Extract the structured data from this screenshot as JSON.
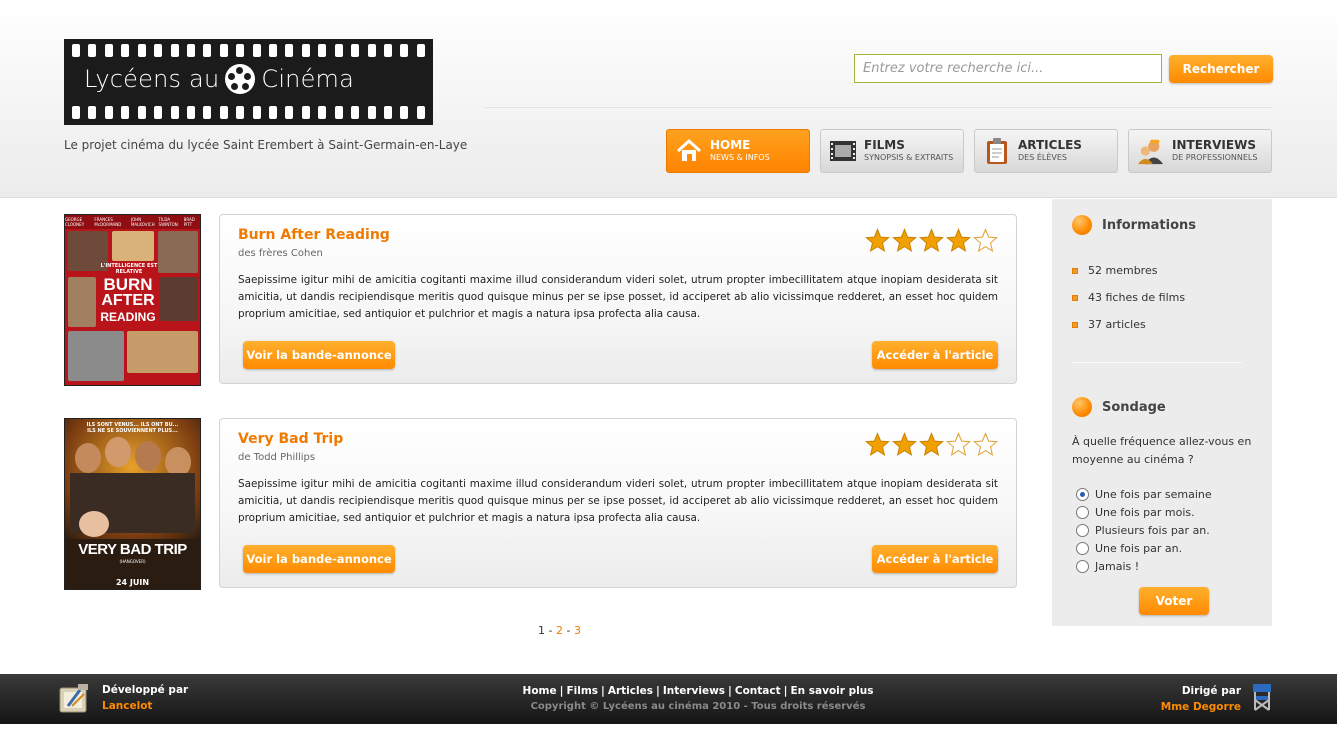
{
  "header": {
    "logo_text_left": "Lycéens au",
    "logo_text_right": "Cinéma",
    "tagline": "Le projet cinéma du lycée Saint Erembert à Saint-Germain-en-Laye",
    "search": {
      "placeholder": "Entrez votre recherche ici...",
      "button_label": "Rechercher"
    },
    "nav": [
      {
        "title": "HOME",
        "subtitle": "NEWS & INFOS",
        "icon": "house-icon",
        "active": true
      },
      {
        "title": "FILMS",
        "subtitle": "SYNOPSIS & EXTRAITS",
        "icon": "film-strip-icon",
        "active": false
      },
      {
        "title": "ARTICLES",
        "subtitle": "DES ÉLÈVES",
        "icon": "clipboard-icon",
        "active": false
      },
      {
        "title": "INTERVIEWS",
        "subtitle": "DE PROFESSIONNELS",
        "icon": "interview-people-icon",
        "active": false
      }
    ]
  },
  "films": [
    {
      "title": "Burn After Reading",
      "director": "des frères Cohen",
      "rating": 4,
      "rating_max": 5,
      "text": "Saepissime igitur mihi de amicitia cogitanti maxime illud considerandum videri solet, utrum propter imbecillitatem atque inopiam desiderata sit amicitia, ut dandis recipiendisque meritis quod quisque minus per se ipse posset, id acciperet ab alio vicissimque redderet, an esset hoc quidem proprium amicitiae, sed antiquior et pulchrior et magis a natura ipsa profecta alia causa.",
      "trailer_label": "Voir la bande-annonce",
      "article_label": "Accéder à l'article",
      "poster": {
        "top_names": [
          "GEORGE CLOONEY",
          "FRANCES McDORMAND",
          "JOHN MALKOVICH",
          "TILDA SWINTON",
          "BRAD PITT"
        ],
        "tagline": "L'INTELLIGENCE EST RELATIVE",
        "title_line1": "BURN",
        "title_line2": "AFTER",
        "title_line3": "READING",
        "colors": {
          "bg": "#b8141a",
          "accent": "#f3d44a"
        }
      }
    },
    {
      "title": "Very Bad Trip",
      "director": "de Todd Phillips",
      "rating": 3,
      "rating_max": 5,
      "text": "Saepissime igitur mihi de amicitia cogitanti maxime illud considerandum videri solet, utrum propter imbecillitatem atque inopiam desiderata sit amicitia, ut dandis recipiendisque meritis quod quisque minus per se ipse posset, id acciperet ab alio vicissimque redderet, an esset hoc quidem proprium amicitiae, sed antiquior et pulchrior et magis a natura ipsa profecta alia causa.",
      "trailer_label": "Voir la bande-annonce",
      "article_label": "Accéder à l'article",
      "poster": {
        "top_line1": "ILS SONT VENUS... ILS ONT BU...",
        "top_line2": "ILS NE SE SOUVIENNENT PLUS...",
        "title": "VERY BAD TRIP",
        "subtitle": "(HANGOVER)",
        "date": "24 JUIN",
        "colors": {
          "bg": "#2a1c10",
          "accent": "#e7a12a"
        }
      }
    }
  ],
  "pagination": {
    "current": "1",
    "pages": [
      "2",
      "3"
    ],
    "sep": "-"
  },
  "sidebar": {
    "info": {
      "title": "Informations",
      "items": [
        "52 membres",
        "43 fiches de films",
        "37 articles"
      ]
    },
    "poll": {
      "title": "Sondage",
      "question": "À quelle fréquence allez-vous en moyenne au cinéma ?",
      "options": [
        {
          "label": "Une fois par semaine",
          "checked": true
        },
        {
          "label": "Une fois par mois.",
          "checked": false
        },
        {
          "label": "Plusieurs fois par an.",
          "checked": false
        },
        {
          "label": "Une fois par an.",
          "checked": false
        },
        {
          "label": "Jamais !",
          "checked": false
        }
      ],
      "vote_label": "Voter"
    }
  },
  "footer": {
    "left_label": "Développé par",
    "left_name": "Lancelot",
    "links": [
      "Home",
      "Films",
      "Articles",
      "Interviews",
      "Contact",
      "En savoir plus"
    ],
    "link_sep": "|",
    "copyright": "Copyright © Lycéens au cinéma 2010 - Tous droits réservés",
    "right_label": "Dirigé par",
    "right_name": "Mme Degorre"
  },
  "colors": {
    "accent": "#ff8a00",
    "title_orange": "#f07a00",
    "footer_bg": "#1f1f1f",
    "sidebar_bg": "#ececec"
  }
}
